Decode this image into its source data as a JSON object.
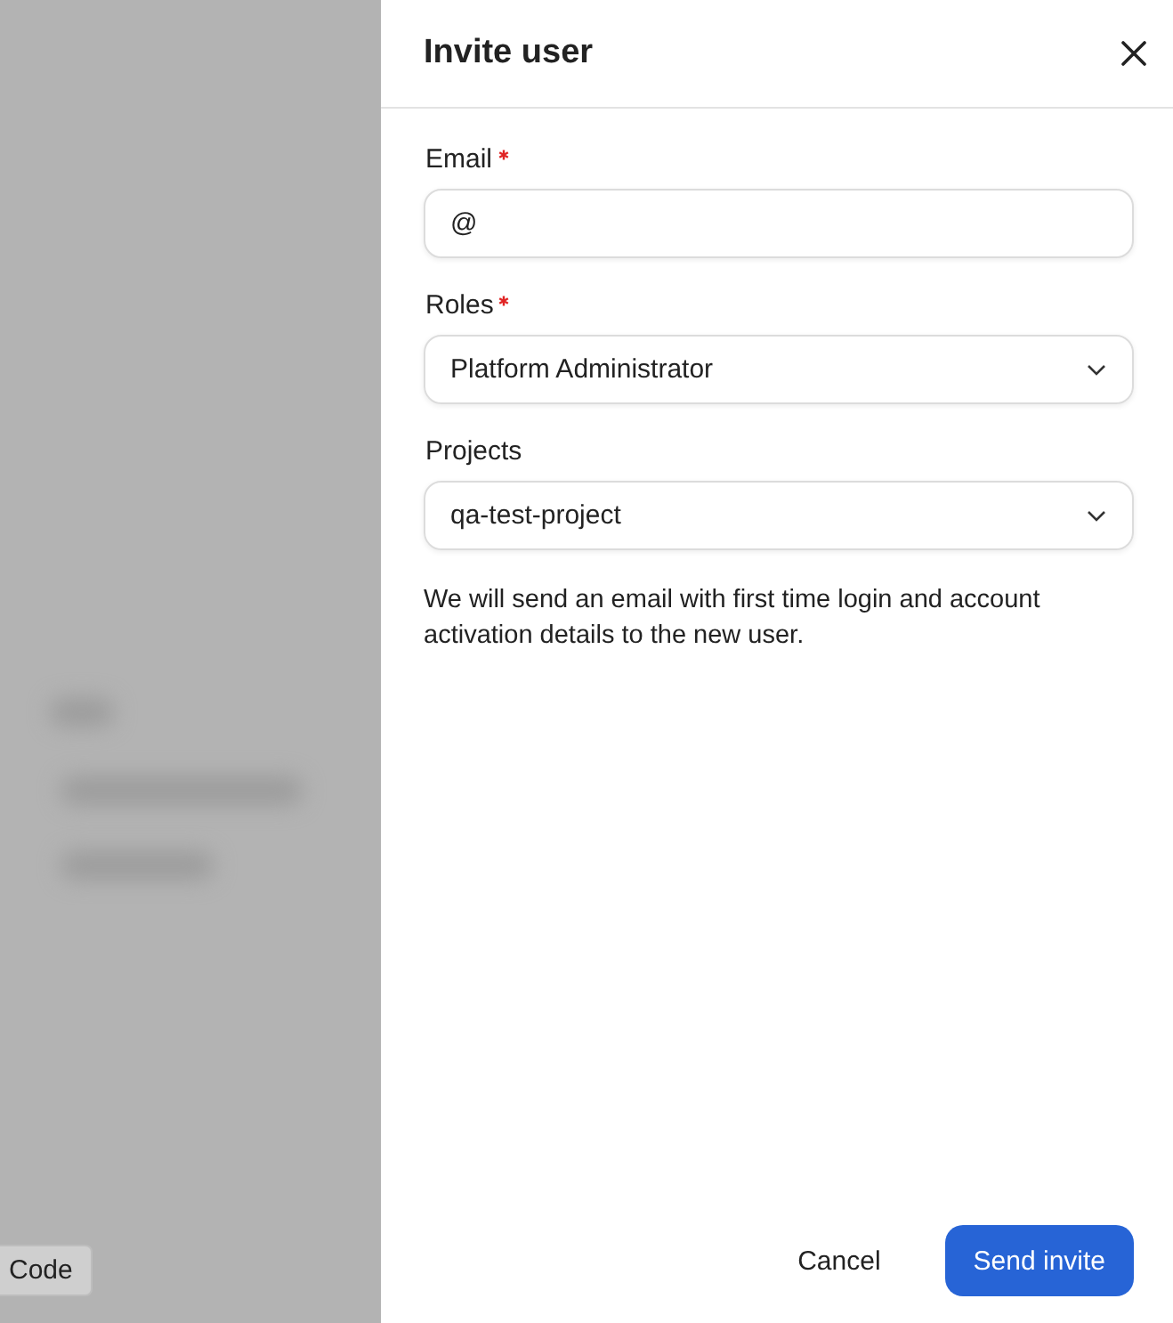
{
  "background": {
    "code_button": "Code"
  },
  "panel": {
    "title": "Invite user",
    "fields": [
      {
        "kind": "text",
        "label": "Email",
        "required": true,
        "value": "@"
      },
      {
        "kind": "select",
        "label": "Roles",
        "required": true,
        "value": "Platform Administrator"
      },
      {
        "kind": "select",
        "label": "Projects",
        "required": false,
        "value": "qa-test-project"
      }
    ],
    "note": "We will send an email with first time login and account activation details to the new user.",
    "buttons": [
      {
        "kind": "secondary",
        "label": "Cancel"
      },
      {
        "kind": "primary",
        "label": "Send invite"
      }
    ]
  }
}
